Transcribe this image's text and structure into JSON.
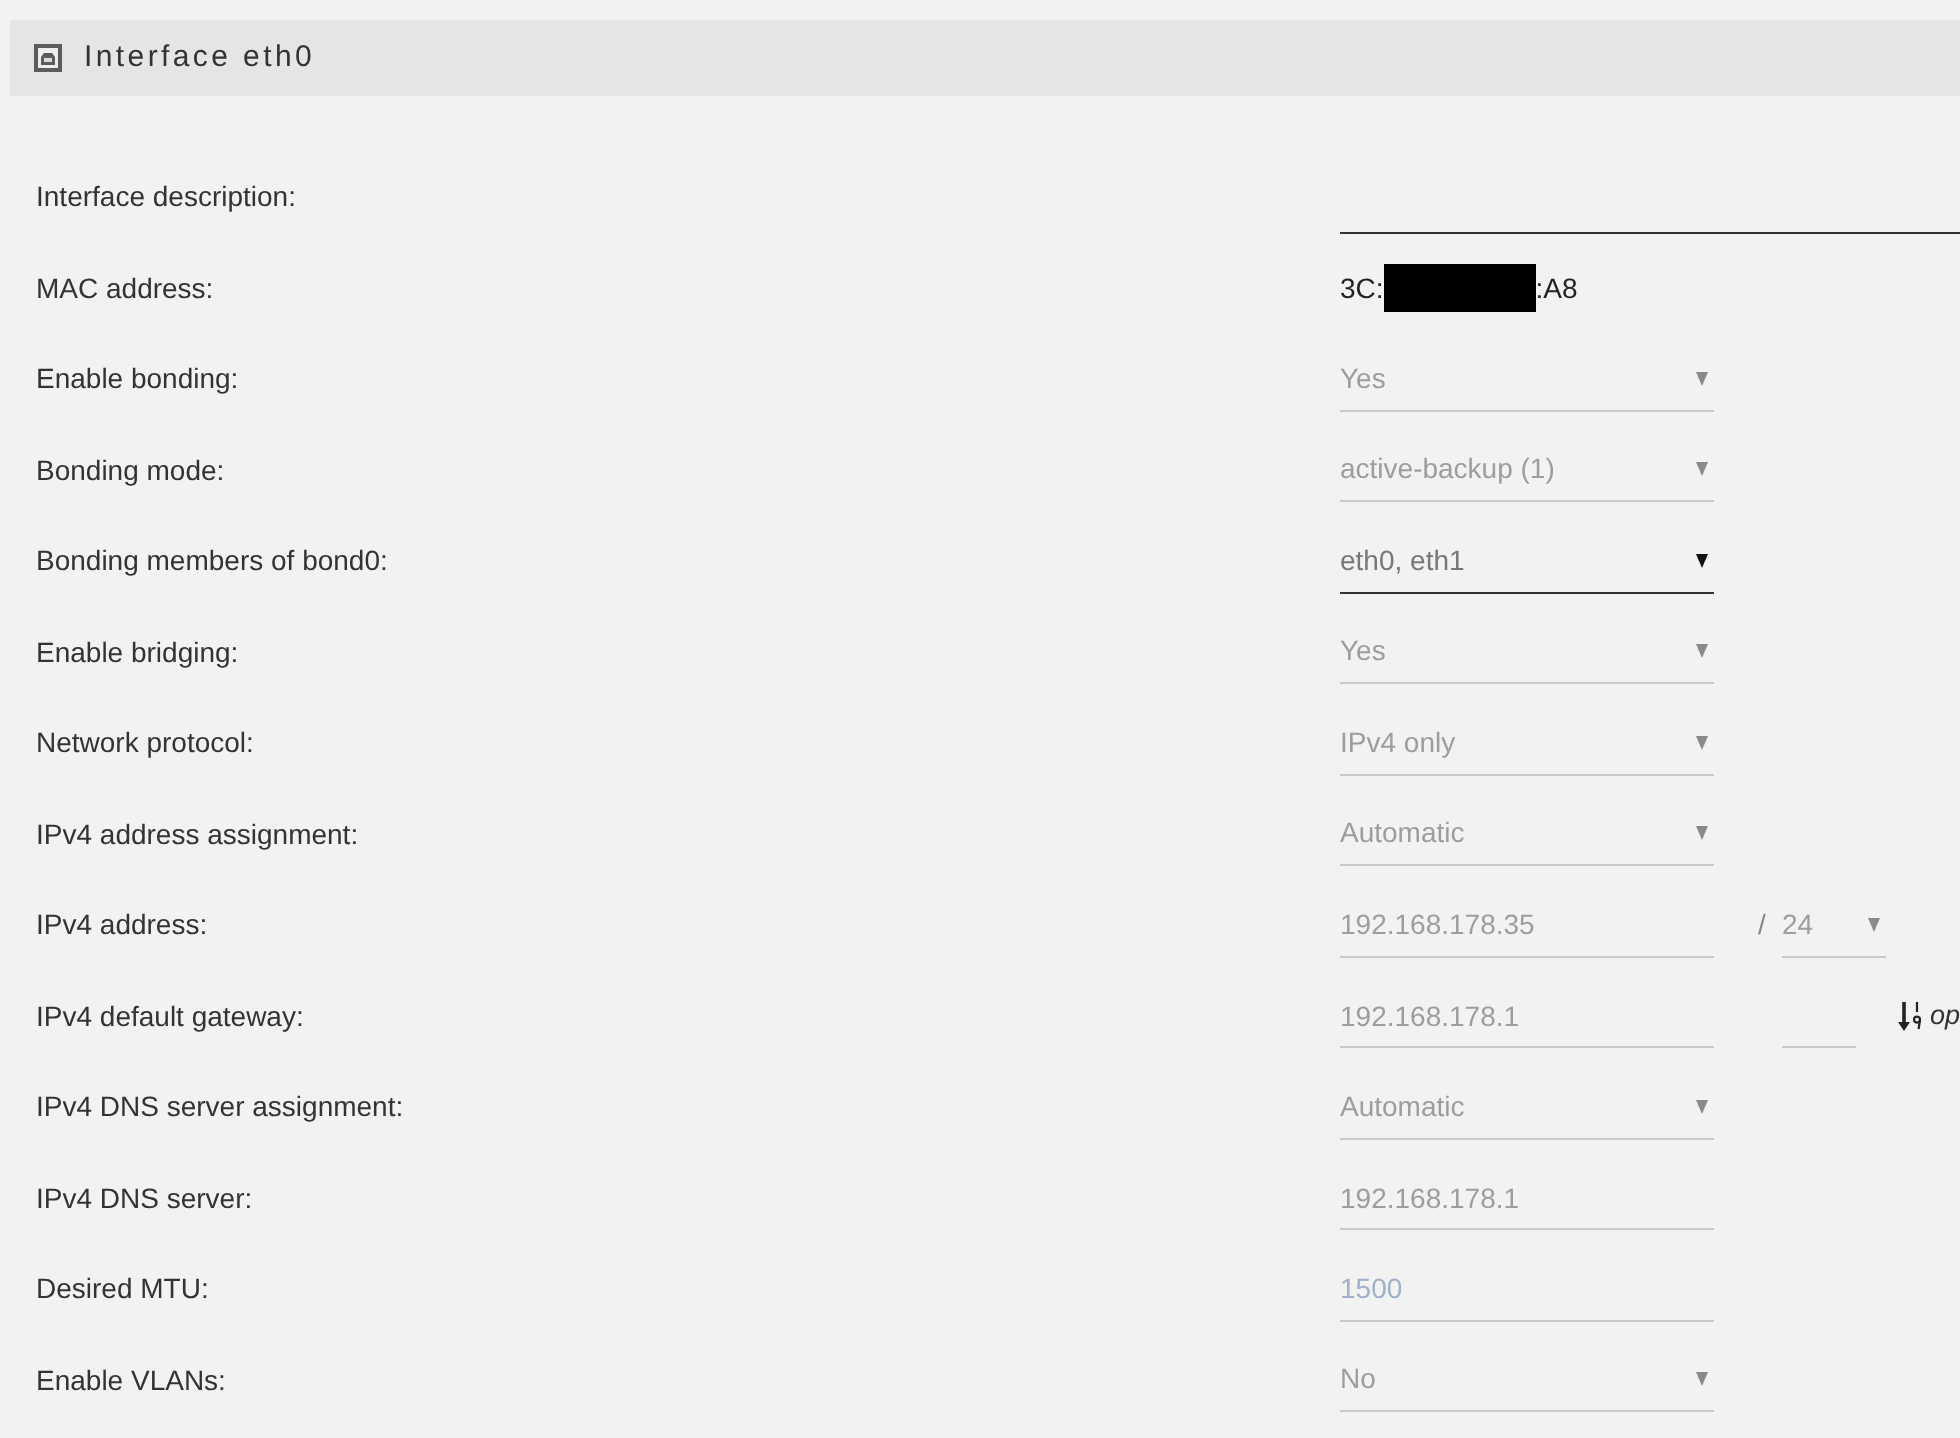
{
  "header": {
    "title": "Interface eth0"
  },
  "rows": [
    {
      "label": "Interface description:",
      "controls": [
        {
          "kind": "wide_input",
          "disabled": false
        }
      ]
    },
    {
      "label": "MAC address:",
      "controls": [
        {
          "kind": "static",
          "value_start": "3C:",
          "value_end": ":A8",
          "redacted": true
        }
      ]
    },
    {
      "label": "Enable bonding:",
      "controls": [
        {
          "kind": "select",
          "value": "Yes",
          "disabled": true
        }
      ]
    },
    {
      "label": "Bonding mode:",
      "controls": [
        {
          "kind": "select",
          "value": "active-backup (1)",
          "disabled": true
        }
      ]
    },
    {
      "label": "Bonding members of bond0:",
      "controls": [
        {
          "kind": "select",
          "value": "eth0, eth1",
          "disabled": false
        }
      ]
    },
    {
      "label": "Enable bridging:",
      "controls": [
        {
          "kind": "select",
          "value": "Yes",
          "disabled": true
        }
      ]
    },
    {
      "label": "Network protocol:",
      "controls": [
        {
          "kind": "select",
          "value": "IPv4 only",
          "disabled": true
        }
      ]
    },
    {
      "label": "IPv4 address assignment:",
      "controls": [
        {
          "kind": "select",
          "value": "Automatic",
          "disabled": true
        }
      ]
    },
    {
      "label": "IPv4 address:",
      "controls": [
        {
          "kind": "input",
          "value": "192.168.178.35",
          "disabled": true
        },
        {
          "kind": "separator",
          "text": "/"
        },
        {
          "kind": "short_select",
          "value": "24",
          "disabled": true
        }
      ]
    },
    {
      "label": "IPv4 default gateway:",
      "controls": [
        {
          "kind": "input",
          "value": "192.168.178.1",
          "disabled": true
        },
        {
          "kind": "short_input",
          "disabled": true
        },
        {
          "kind": "hint",
          "text": "op"
        }
      ]
    },
    {
      "label": "IPv4 DNS server assignment:",
      "controls": [
        {
          "kind": "select",
          "value": "Automatic",
          "disabled": true
        }
      ]
    },
    {
      "label": "IPv4 DNS server:",
      "controls": [
        {
          "kind": "input",
          "value": "192.168.178.1",
          "disabled": true
        }
      ]
    },
    {
      "label": "Desired MTU:",
      "controls": [
        {
          "kind": "input",
          "placeholder": "1500",
          "disabled": true
        }
      ]
    },
    {
      "label": "Enable VLANs:",
      "controls": [
        {
          "kind": "select",
          "value": "No",
          "disabled": true
        }
      ]
    }
  ]
}
